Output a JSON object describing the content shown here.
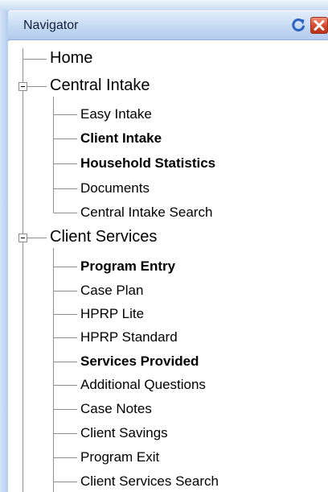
{
  "panel": {
    "title": "Navigator",
    "icons": {
      "refresh": "refresh-icon",
      "close": "close-icon"
    },
    "colors": {
      "header": "#c6d9f3",
      "close": "#d4462a",
      "refresh": "#2a63c4"
    }
  },
  "tree": {
    "home": {
      "label": "Home"
    },
    "central_intake": {
      "label": "Central Intake",
      "expanded": true,
      "items": [
        {
          "label": "Easy Intake",
          "bold": false
        },
        {
          "label": "Client Intake",
          "bold": true
        },
        {
          "label": "Household Statistics",
          "bold": true
        },
        {
          "label": "Documents",
          "bold": false
        },
        {
          "label": "Central Intake Search",
          "bold": false
        }
      ]
    },
    "client_services": {
      "label": "Client Services",
      "expanded": true,
      "items": [
        {
          "label": "Program Entry",
          "bold": true
        },
        {
          "label": "Case Plan",
          "bold": false
        },
        {
          "label": "HPRP Lite",
          "bold": false
        },
        {
          "label": "HPRP Standard",
          "bold": false
        },
        {
          "label": "Services Provided",
          "bold": true
        },
        {
          "label": "Additional Questions",
          "bold": false
        },
        {
          "label": "Case Notes",
          "bold": false
        },
        {
          "label": "Client Savings",
          "bold": false
        },
        {
          "label": "Program Exit",
          "bold": false
        },
        {
          "label": "Client Services Search",
          "bold": false
        }
      ]
    }
  }
}
